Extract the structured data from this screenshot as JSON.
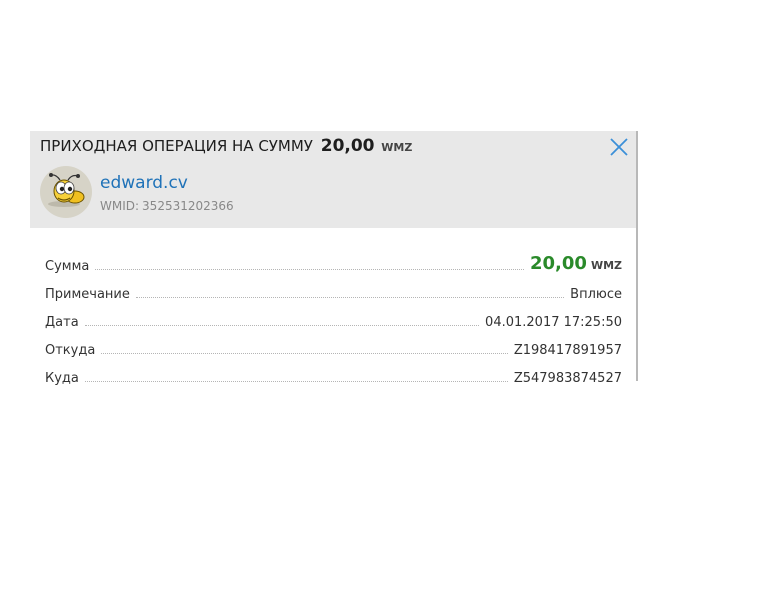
{
  "title": {
    "prefix": "ПРИХОДНАЯ ОПЕРАЦИЯ НА СУММУ",
    "amount": "20,00",
    "currency": "WMZ"
  },
  "close_icon": "close-icon",
  "user": {
    "avatar_icon": "bee-avatar-icon",
    "name": "edward.cv",
    "wmid_label": "WMID:",
    "wmid": "352531202366"
  },
  "details": {
    "sum_label": "Сумма",
    "sum_value": "20,00",
    "sum_currency": "WMZ",
    "note_label": "Примечание",
    "note_value": "Вплюсе",
    "date_label": "Дата",
    "date_value": "04.01.2017 17:25:50",
    "from_label": "Откуда",
    "from_value": "Z198417891957",
    "to_label": "Куда",
    "to_value": "Z547983874527"
  },
  "colors": {
    "header_bg": "#e8e8e8",
    "link": "#1f72b8",
    "amount_green": "#2a8a2a",
    "close_blue": "#3b8fd8"
  }
}
